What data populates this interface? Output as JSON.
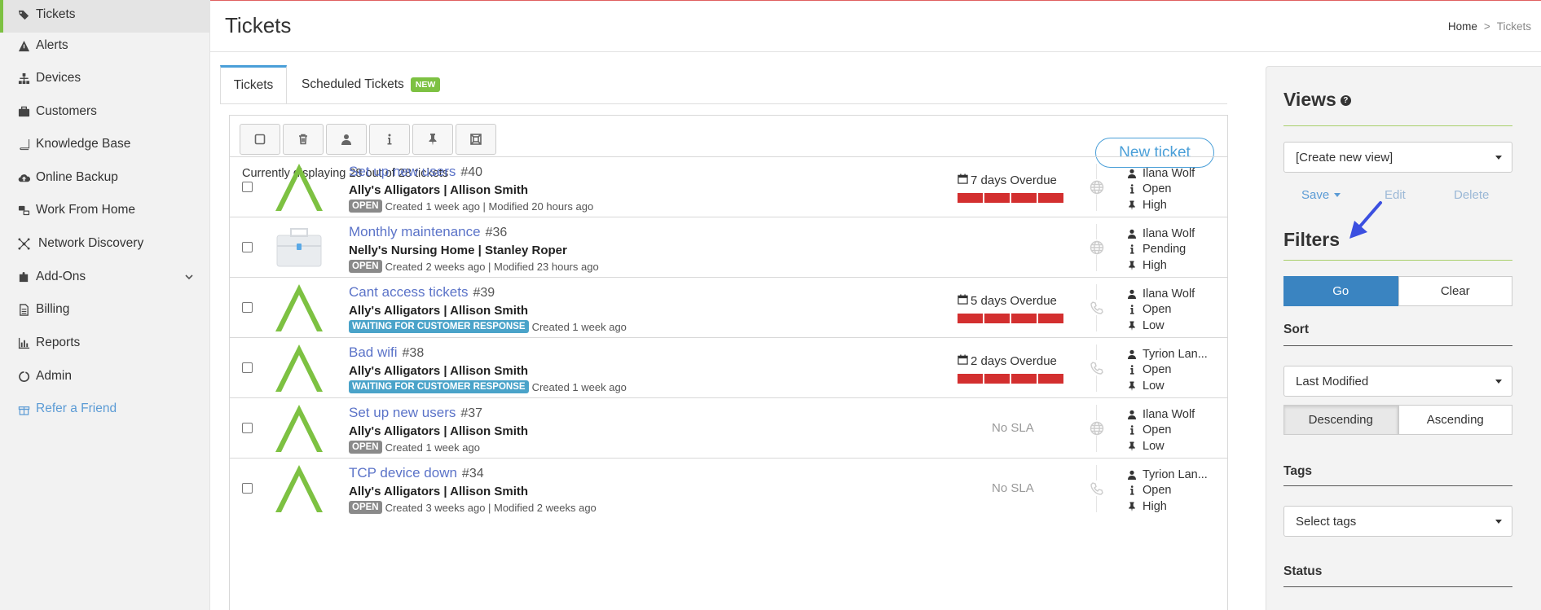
{
  "sidebar": {
    "items": [
      {
        "label": "Tickets",
        "icon": "tags-icon"
      },
      {
        "label": "Alerts",
        "icon": "warning-icon"
      },
      {
        "label": "Devices",
        "icon": "sitemap-icon"
      },
      {
        "label": "Customers",
        "icon": "briefcase-icon"
      },
      {
        "label": "Knowledge Base",
        "icon": "book-icon"
      },
      {
        "label": "Online Backup",
        "icon": "cloud-upload-icon"
      },
      {
        "label": "Work From Home",
        "icon": "remote-desktop-icon"
      },
      {
        "label": "Network Discovery",
        "icon": "network-icon"
      },
      {
        "label": "Add-Ons",
        "icon": "puzzle-icon"
      },
      {
        "label": "Billing",
        "icon": "file-icon"
      },
      {
        "label": "Reports",
        "icon": "bar-chart-icon"
      },
      {
        "label": "Admin",
        "icon": "circle-notch-icon"
      },
      {
        "label": "Refer a Friend",
        "icon": "gift-icon"
      }
    ]
  },
  "header": {
    "title": "Tickets",
    "breadcrumb": {
      "home": "Home",
      "sep": ">",
      "current": "Tickets"
    }
  },
  "tabs": {
    "tickets": "Tickets",
    "scheduled": "Scheduled Tickets",
    "new_badge": "NEW"
  },
  "panel": {
    "new_ticket": "New ticket",
    "displaying": "Currently displaying 28 out of 28 tickets"
  },
  "tickets": [
    {
      "title": "Set up new users",
      "number": "#40",
      "customer": "Ally's Alligators | Allison Smith",
      "status": "OPEN",
      "meta": "Created 1 week ago | Modified 20 hours ago",
      "sla": "7 days Overdue",
      "type": "globe-icon",
      "assignee": "Ilana Wolf",
      "state": "Open",
      "priority": "High"
    },
    {
      "title": "Monthly maintenance",
      "number": "#36",
      "customer": "Nelly's Nursing Home | Stanley Roper",
      "status": "OPEN",
      "meta": "Created 2 weeks ago | Modified 23 hours ago",
      "sla": "",
      "type": "globe-icon",
      "assignee": "Ilana Wolf",
      "state": "Pending",
      "priority": "High"
    },
    {
      "title": "Cant access tickets",
      "number": "#39",
      "customer": "Ally's Alligators | Allison Smith",
      "status": "WAITING FOR CUSTOMER RESPONSE",
      "meta": "Created 1 week ago",
      "sla": "5 days Overdue",
      "type": "phone-icon",
      "assignee": "Ilana Wolf",
      "state": "Open",
      "priority": "Low"
    },
    {
      "title": "Bad wifi",
      "number": "#38",
      "customer": "Ally's Alligators | Allison Smith",
      "status": "WAITING FOR CUSTOMER RESPONSE",
      "meta": "Created 1 week ago",
      "sla": "2 days Overdue",
      "type": "phone-icon",
      "assignee": "Tyrion Lan...",
      "state": "Open",
      "priority": "Low"
    },
    {
      "title": "Set up new users",
      "number": "#37",
      "customer": "Ally's Alligators | Allison Smith",
      "status": "OPEN",
      "meta": "Created 1 week ago",
      "sla": "No SLA",
      "type": "globe-icon",
      "assignee": "Ilana Wolf",
      "state": "Open",
      "priority": "Low"
    },
    {
      "title": "TCP device down",
      "number": "#34",
      "customer": "Ally's Alligators | Allison Smith",
      "status": "OPEN",
      "meta": "Created 3 weeks ago | Modified 2 weeks ago",
      "sla": "No SLA",
      "type": "phone-icon",
      "assignee": "Tyrion Lan...",
      "state": "Open",
      "priority": "High"
    }
  ],
  "views": {
    "title": "Views",
    "select": "[Create new view]",
    "save": "Save",
    "edit": "Edit",
    "delete": "Delete"
  },
  "filters": {
    "title": "Filters",
    "go": "Go",
    "clear": "Clear",
    "sort_label": "Sort",
    "sort_value": "Last Modified",
    "descending": "Descending",
    "ascending": "Ascending",
    "tags_label": "Tags",
    "tags_placeholder": "Select tags",
    "status_label": "Status"
  },
  "colors": {
    "accent": "#4a9fd8",
    "green": "#7dc142",
    "overdue": "#d32f2f",
    "go": "#3a84c1"
  }
}
